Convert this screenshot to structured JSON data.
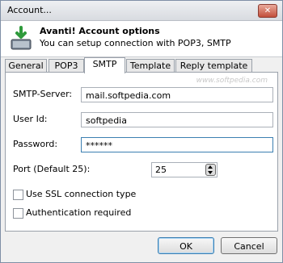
{
  "window": {
    "title": "Account...",
    "close_glyph": "✕"
  },
  "header": {
    "title": "Avanti! Account options",
    "subtitle": "You can setup connection with POP3, SMTP",
    "icon": "account-settings-icon"
  },
  "tabs": [
    {
      "label": "General",
      "active": false
    },
    {
      "label": "POP3",
      "active": false
    },
    {
      "label": "SMTP",
      "active": true
    },
    {
      "label": "Template",
      "active": false
    },
    {
      "label": "Reply template",
      "active": false
    }
  ],
  "watermark": "www.softpedia.com",
  "smtp": {
    "server_label": "SMTP-Server:",
    "server_value": "mail.softpedia.com",
    "user_label": "User Id:",
    "user_value": "softpedia",
    "password_label": "Password:",
    "password_value": "******",
    "port_label": "Port (Default 25):",
    "port_value": "25",
    "ssl_label": "Use SSL connection type",
    "ssl_checked": false,
    "auth_label": "Authentication required",
    "auth_checked": false
  },
  "buttons": {
    "ok": "OK",
    "cancel": "Cancel"
  }
}
